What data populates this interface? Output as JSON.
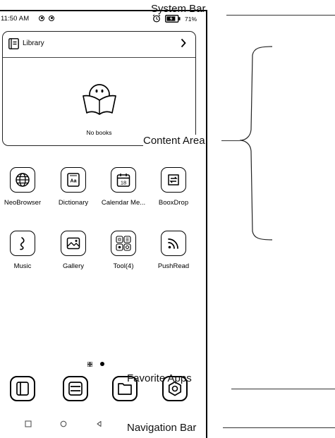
{
  "status_bar": {
    "time": "11:50 AM",
    "battery": "71%"
  },
  "library": {
    "title": "Library",
    "empty_message": "No books"
  },
  "apps": [
    {
      "label": "NeoBrowser",
      "icon": "globe-icon"
    },
    {
      "label": "Dictionary",
      "icon": "dictionary-icon"
    },
    {
      "label": "Calendar Me...",
      "icon": "calendar-icon",
      "day": "18"
    },
    {
      "label": "BooxDrop",
      "icon": "transfer-icon"
    },
    {
      "label": "Music",
      "icon": "music-note-icon"
    },
    {
      "label": "Gallery",
      "icon": "image-icon"
    },
    {
      "label": "Tool(4)",
      "icon": "tools-folder-icon"
    },
    {
      "label": "PushRead",
      "icon": "rss-feed-icon"
    }
  ],
  "dock": [
    {
      "icon": "book-reader-icon"
    },
    {
      "icon": "notes-stack-icon"
    },
    {
      "icon": "folder-icon"
    },
    {
      "icon": "settings-gear-icon"
    }
  ],
  "navigation": [
    {
      "icon": "recents-square-icon"
    },
    {
      "icon": "home-circle-icon"
    },
    {
      "icon": "back-triangle-icon"
    }
  ],
  "annotations": {
    "system_bar": "System Bar",
    "content_area": "Content Area",
    "favorite_apps": "Favorite Apps",
    "navigation_bar": "Navigation Bar"
  }
}
